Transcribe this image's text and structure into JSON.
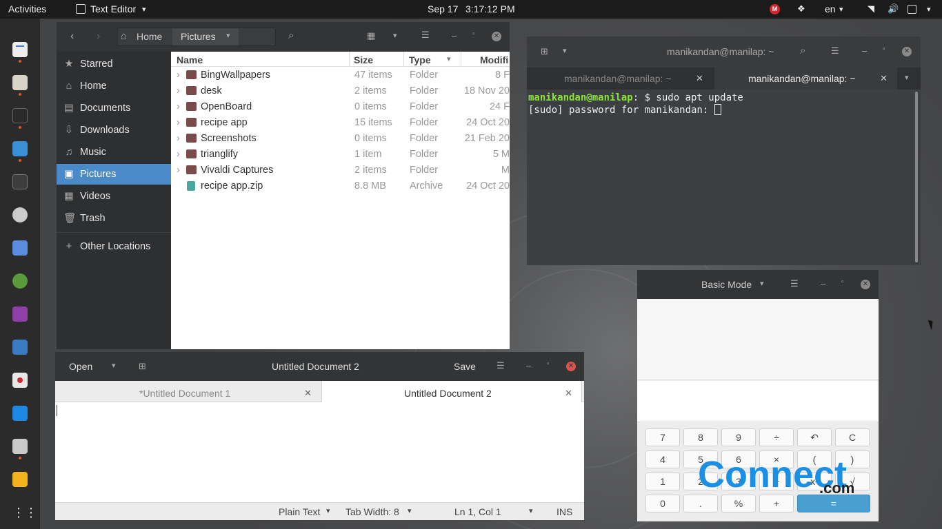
{
  "topbar": {
    "activities": "Activities",
    "app_name": "Text Editor",
    "date": "Sep 17",
    "time": "3:17:12 PM",
    "lang": "en"
  },
  "files": {
    "path": [
      "Home",
      "Pictures"
    ],
    "sidebar": [
      {
        "label": "Starred",
        "icon": "★"
      },
      {
        "label": "Home",
        "icon": "⌂"
      },
      {
        "label": "Documents",
        "icon": "▤"
      },
      {
        "label": "Downloads",
        "icon": "⇩"
      },
      {
        "label": "Music",
        "icon": "♫"
      },
      {
        "label": "Pictures",
        "icon": "▣"
      },
      {
        "label": "Videos",
        "icon": "▦"
      },
      {
        "label": "Trash",
        "icon": "🗑"
      },
      {
        "label": "Other Locations",
        "icon": "+"
      }
    ],
    "columns": {
      "name": "Name",
      "size": "Size",
      "type": "Type",
      "modified": "Modifi"
    },
    "rows": [
      {
        "name": "BingWallpapers",
        "size": "47 items",
        "type": "Folder",
        "modified": "8 F"
      },
      {
        "name": "desk",
        "size": "2 items",
        "type": "Folder",
        "modified": "18 Nov 20"
      },
      {
        "name": "OpenBoard",
        "size": "0 items",
        "type": "Folder",
        "modified": "24 F"
      },
      {
        "name": "recipe app",
        "size": "15 items",
        "type": "Folder",
        "modified": "24 Oct 20"
      },
      {
        "name": "Screenshots",
        "size": "0 items",
        "type": "Folder",
        "modified": "21 Feb 20"
      },
      {
        "name": "trianglify",
        "size": "1 item",
        "type": "Folder",
        "modified": "5 M"
      },
      {
        "name": "Vivaldi Captures",
        "size": "2 items",
        "type": "Folder",
        "modified": "M"
      },
      {
        "name": "recipe app.zip",
        "size": "8.8 MB",
        "type": "Archive",
        "modified": "24 Oct 20"
      }
    ]
  },
  "terminal": {
    "title": "manikandan@manilap: ~",
    "tabs": [
      "manikandan@manilap: ~",
      "manikandan@manilap: ~"
    ],
    "prompt_user": "manikandan@manilap",
    "prompt_rest": ": $ sudo apt update",
    "line2": "[sudo] password for manikandan: "
  },
  "gedit": {
    "open": "Open",
    "title": "Untitled Document 2",
    "save": "Save",
    "tabs": [
      "*Untitled Document 1",
      "Untitled Document 2"
    ],
    "status_lang": "Plain Text",
    "status_tab": "Tab Width: 8",
    "status_pos": "Ln 1, Col 1",
    "status_mode": "INS"
  },
  "calculator": {
    "mode": "Basic Mode",
    "keys": [
      [
        "7",
        "8",
        "9",
        "÷",
        "↶",
        "C"
      ],
      [
        "4",
        "5",
        "6",
        "×",
        "(",
        ")"
      ],
      [
        "1",
        "2",
        "3",
        "−",
        "x²",
        "√"
      ],
      [
        "0",
        ".",
        "%",
        "+",
        "="
      ]
    ]
  },
  "watermark": {
    "text": "Connect",
    "suffix": ".com"
  }
}
